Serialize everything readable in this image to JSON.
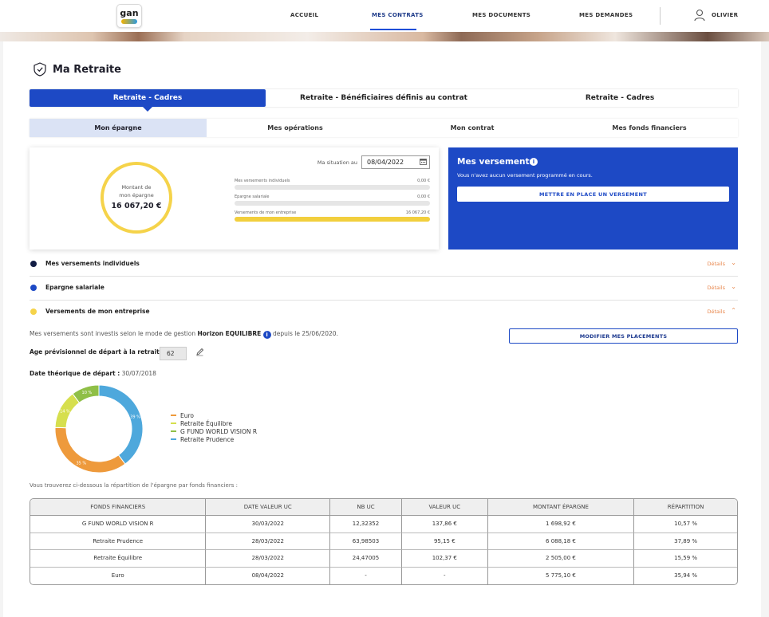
{
  "header": {
    "logo_text": "gan",
    "nav": [
      "ACCUEIL",
      "MES CONTRATS",
      "MES DOCUMENTS",
      "MES DEMANDES"
    ],
    "user_name": "OLIVIER"
  },
  "page_title": "Ma Retraite",
  "contract_tabs": [
    "Retraite - Cadres",
    "Retraite - Bénéficiaires définis au contrat",
    "Retraite - Cadres"
  ],
  "sub_tabs": [
    "Mon épargne",
    "Mes opérations",
    "Mon contrat",
    "Mes fonds financiers"
  ],
  "summary": {
    "ring_label_1": "Montant de",
    "ring_label_2": "mon épargne",
    "total": "16 067,20 €",
    "situation_label": "Ma situation au",
    "situation_date": "08/04/2022",
    "rows": [
      {
        "label": "Mes versements individuels",
        "value": "0,00 €",
        "fill": 0
      },
      {
        "label": "Epargne salariale",
        "value": "0,00 €",
        "fill": 0
      },
      {
        "label": "Versements de mon entreprise",
        "value": "16 067,20 €",
        "fill": 1
      }
    ]
  },
  "versements": {
    "title": "Mes versements",
    "text": "Vous n'avez aucun versement programmé en cours.",
    "button": "METTRE EN PLACE UN VERSEMENT"
  },
  "accordion": [
    {
      "label": "Mes versements individuels",
      "details": "Détails",
      "color": "#111c44",
      "chevron": "⌄"
    },
    {
      "label": "Epargne salariale",
      "details": "Détails",
      "color": "#1d49c5",
      "chevron": "⌄"
    },
    {
      "label": "Versements de mon entreprise",
      "details": "Détails",
      "color": "#f5d34a",
      "chevron": "⌃"
    }
  ],
  "investment": {
    "text_before": "Mes versements sont investis selon le mode de gestion ",
    "mode": "Horizon EQUILIBRE",
    "text_after": " depuis le 25/06/2020.",
    "modify_button": "MODIFIER MES PLACEMENTS",
    "age_label": "Age prévisionnel de départ à la retraite :",
    "age_value": "62",
    "depart_label": "Date théorique de départ :",
    "depart_date": "30/07/2018"
  },
  "chart_data": {
    "type": "pie",
    "donut": true,
    "categories": [
      "Euro",
      "Retraite Équilibre",
      "G FUND WORLD VISION R",
      "Retraite Prudence"
    ],
    "values": [
      35,
      14,
      10,
      39
    ],
    "colors": [
      "#ee9a3c",
      "#d6df4e",
      "#8fbf47",
      "#4ea8dc"
    ]
  },
  "repartition_text": "Vous trouverez ci-dessous la répartition de l'épargne par fonds financiers :",
  "table": {
    "headers": [
      "FONDS FINANCIERS",
      "DATE VALEUR UC",
      "NB UC",
      "VALEUR UC",
      "MONTANT ÉPARGNE",
      "RÉPARTITION"
    ],
    "rows": [
      [
        "G FUND WORLD VISION R",
        "30/03/2022",
        "12,32352",
        "137,86 €",
        "1 698,92 €",
        "10,57 %"
      ],
      [
        "Retraite Prudence",
        "28/03/2022",
        "63,98503",
        "95,15 €",
        "6 088,18 €",
        "37,89 %"
      ],
      [
        "Retraite Équilibre",
        "28/03/2022",
        "24,47005",
        "102,37 €",
        "2 505,00 €",
        "15,59 %"
      ],
      [
        "Euro",
        "08/04/2022",
        "-",
        "-",
        "5 775,10 €",
        "35,94 %"
      ]
    ]
  }
}
